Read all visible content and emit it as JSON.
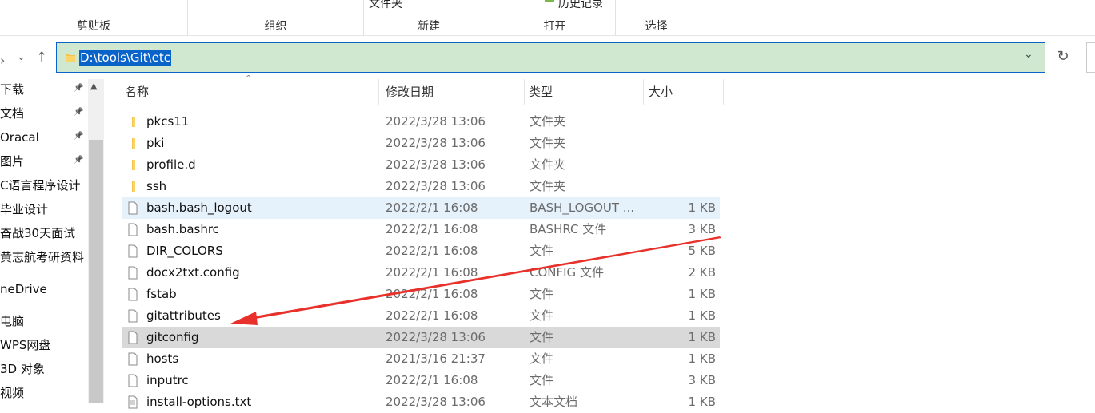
{
  "ribbon": {
    "top_texts": {
      "new_folder": "文件夹",
      "history": "历史记录"
    },
    "groups": [
      {
        "label": "剪贴板"
      },
      {
        "label": "组织"
      },
      {
        "label": "新建"
      },
      {
        "label": "打开"
      },
      {
        "label": "选择"
      }
    ]
  },
  "address": {
    "path": "D:\\tools\\Git\\etc",
    "dropdown_icon": "chevron-down-icon",
    "refresh_icon": "refresh-icon"
  },
  "sidebar": {
    "items": [
      {
        "label": "下载",
        "pinned": true
      },
      {
        "label": "文档",
        "pinned": true
      },
      {
        "label": "Oracal",
        "pinned": true
      },
      {
        "label": "图片",
        "pinned": true
      },
      {
        "label": "C语言程序设计",
        "pinned": false
      },
      {
        "label": "毕业设计",
        "pinned": false
      },
      {
        "label": "奋战30天面试",
        "pinned": false
      },
      {
        "label": "黄志航考研资料",
        "pinned": false
      },
      {
        "label": "neDrive",
        "pinned": false
      },
      {
        "label": "电脑",
        "pinned": false
      },
      {
        "label": "WPS网盘",
        "pinned": false
      },
      {
        "label": "3D 对象",
        "pinned": false
      },
      {
        "label": "视频",
        "pinned": false
      }
    ]
  },
  "columns": {
    "name": "名称",
    "modified": "修改日期",
    "type": "类型",
    "size": "大小"
  },
  "files": [
    {
      "name": "pkcs11",
      "date": "2022/3/28 13:06",
      "type": "文件夹",
      "size": "",
      "kind": "folder",
      "state": ""
    },
    {
      "name": "pki",
      "date": "2022/3/28 13:06",
      "type": "文件夹",
      "size": "",
      "kind": "folder",
      "state": ""
    },
    {
      "name": "profile.d",
      "date": "2022/3/28 13:06",
      "type": "文件夹",
      "size": "",
      "kind": "folder",
      "state": ""
    },
    {
      "name": "ssh",
      "date": "2022/3/28 13:06",
      "type": "文件夹",
      "size": "",
      "kind": "folder",
      "state": ""
    },
    {
      "name": "bash.bash_logout",
      "date": "2022/2/1 16:08",
      "type": "BASH_LOGOUT ...",
      "size": "1 KB",
      "kind": "file",
      "state": "hover"
    },
    {
      "name": "bash.bashrc",
      "date": "2022/2/1 16:08",
      "type": "BASHRC 文件",
      "size": "3 KB",
      "kind": "file",
      "state": ""
    },
    {
      "name": "DIR_COLORS",
      "date": "2022/2/1 16:08",
      "type": "文件",
      "size": "5 KB",
      "kind": "file",
      "state": ""
    },
    {
      "name": "docx2txt.config",
      "date": "2022/2/1 16:08",
      "type": "CONFIG 文件",
      "size": "2 KB",
      "kind": "file",
      "state": ""
    },
    {
      "name": "fstab",
      "date": "2022/2/1 16:08",
      "type": "文件",
      "size": "1 KB",
      "kind": "file",
      "state": ""
    },
    {
      "name": "gitattributes",
      "date": "2022/2/1 16:08",
      "type": "文件",
      "size": "1 KB",
      "kind": "file",
      "state": ""
    },
    {
      "name": "gitconfig",
      "date": "2022/3/28 13:06",
      "type": "文件",
      "size": "1 KB",
      "kind": "file",
      "state": "selected"
    },
    {
      "name": "hosts",
      "date": "2021/3/16 21:37",
      "type": "文件",
      "size": "1 KB",
      "kind": "file",
      "state": ""
    },
    {
      "name": "inputrc",
      "date": "2022/2/1 16:08",
      "type": "文件",
      "size": "3 KB",
      "kind": "file",
      "state": ""
    },
    {
      "name": "install-options.txt",
      "date": "2022/3/28 13:06",
      "type": "文本文档",
      "size": "1 KB",
      "kind": "text",
      "state": ""
    }
  ],
  "annotation": {
    "arrow_color": "#e8312a"
  }
}
